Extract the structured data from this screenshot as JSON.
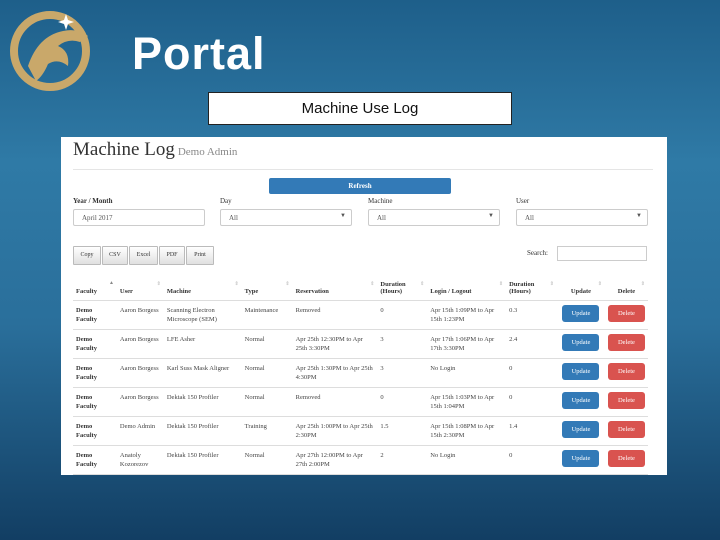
{
  "header": {
    "title": "Portal",
    "label": "Machine Use Log"
  },
  "panel": {
    "title": "Machine Log",
    "subtitle": "Demo Admin",
    "refresh_label": "Refresh"
  },
  "filters": [
    {
      "label": "Year / Month",
      "value": "April 2017"
    },
    {
      "label": "Day",
      "value": "All"
    },
    {
      "label": "Machine",
      "value": "All"
    },
    {
      "label": "User",
      "value": "All"
    }
  ],
  "export_buttons": [
    "Copy",
    "CSV",
    "Excel",
    "PDF",
    "Print"
  ],
  "search_label": "Search:",
  "columns": [
    "Faculty",
    "User",
    "Machine",
    "Type",
    "Reservation",
    "Duration (Hours)",
    "Login / Logout",
    "Duration (Hours)",
    "Update",
    "Delete"
  ],
  "rows": [
    {
      "faculty": "Demo Faculty",
      "user": "Aaron Borgess",
      "machine": "Scanning Electron Microscope (SEM)",
      "type": "Maintenance",
      "reservation": "Removed",
      "dur1": "0",
      "login": "Apr 15th 1:09PM to Apr 15th 1:23PM",
      "dur2": "0.3",
      "update": "Update",
      "delete": "Delete"
    },
    {
      "faculty": "Demo Faculty",
      "user": "Aaron Borgess",
      "machine": "LFE Asher",
      "type": "Normal",
      "reservation": "Apr 25th 12:30PM to Apr 25th 3:30PM",
      "dur1": "3",
      "login": "Apr 17th 1:06PM to Apr 17th 3:30PM",
      "dur2": "2.4",
      "update": "Update",
      "delete": "Delete"
    },
    {
      "faculty": "Demo Faculty",
      "user": "Aaron Borgess",
      "machine": "Karl Suss Mask Aligner",
      "type": "Normal",
      "reservation": "Apr 25th 1:30PM to Apr 25th 4:30PM",
      "dur1": "3",
      "login": "No Login",
      "dur2": "0",
      "update": "Update",
      "delete": "Delete"
    },
    {
      "faculty": "Demo Faculty",
      "user": "Aaron Borgess",
      "machine": "Dektak 150 Profiler",
      "type": "Normal",
      "reservation": "Removed",
      "dur1": "0",
      "login": "Apr 15th 1:03PM to Apr 15th 1:04PM",
      "dur2": "0",
      "update": "Update",
      "delete": "Delete"
    },
    {
      "faculty": "Demo Faculty",
      "user": "Demo Admin",
      "machine": "Dektak 150 Profiler",
      "type": "Training",
      "reservation": "Apr 25th 1:00PM to Apr 25th 2:30PM",
      "dur1": "1.5",
      "login": "Apr 15th 1:08PM to Apr 15th 2:30PM",
      "dur2": "1.4",
      "update": "Update",
      "delete": "Delete"
    },
    {
      "faculty": "Demo Faculty",
      "user": "Anatoly Kozorezov",
      "machine": "Dektak 150 Profiler",
      "type": "Normal",
      "reservation": "Apr 27th 12:00PM to Apr 27th 2:00PM",
      "dur1": "2",
      "login": "No Login",
      "dur2": "0",
      "update": "Update",
      "delete": "Delete"
    }
  ],
  "colors": {
    "primary": "#337ab7",
    "danger": "#d9534f",
    "logo_gold": "#c9a86a"
  }
}
